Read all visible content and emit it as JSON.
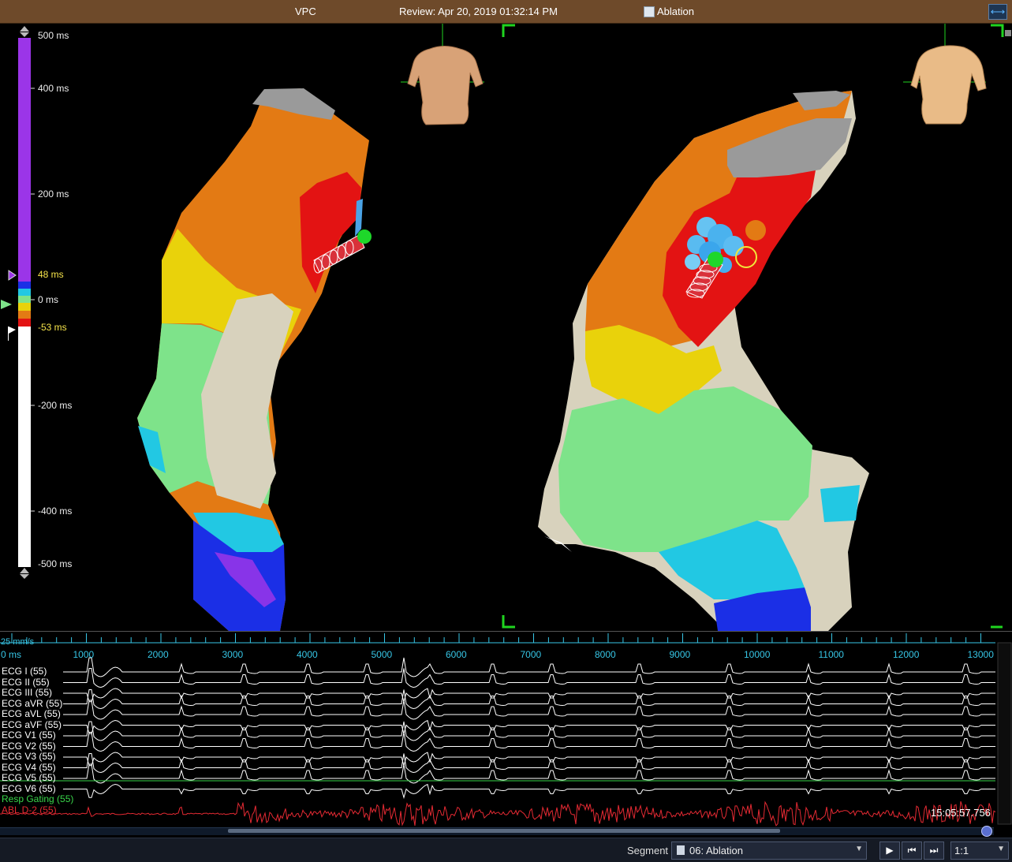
{
  "titlebar": {
    "left": "VPC",
    "center": "Review: Apr 20, 2019 01:32:14 PM",
    "right": "Ablation",
    "expand_icon": "expand-horizontal-icon"
  },
  "colors": {
    "titlebar_bg": "#6e4a2a",
    "purple": "#9b35e8",
    "blue": "#1b2fe6",
    "cyan": "#22c8e3",
    "green": "#7ee38a",
    "yellow": "#e9d20b",
    "orange": "#e37a14",
    "red": "#e31313",
    "white": "#ffffff",
    "ecg_trace": "#ffffff",
    "resp_trace": "#39d64a",
    "abl_trace": "#e52a33",
    "ruler": "#37c6e6"
  },
  "scale": {
    "labels": [
      "500 ms",
      "400 ms",
      "200 ms",
      "48 ms",
      "0 ms",
      "-53 ms",
      "-200 ms",
      "-400 ms",
      "-500 ms"
    ]
  },
  "ecg": {
    "speed": "25 mm/s",
    "ruler_ticks": [
      "0 ms",
      "1000",
      "2000",
      "3000",
      "4000",
      "5000",
      "6000",
      "7000",
      "8000",
      "9000",
      "10000",
      "11000",
      "12000",
      "13000"
    ],
    "channels": [
      "ECG I (55)",
      "ECG II (55)",
      "ECG III (55)",
      "ECG aVR (55)",
      "ECG aVL (55)",
      "ECG aVF (55)",
      "ECG V1 (55)",
      "ECG V2 (55)",
      "ECG V3 (55)",
      "ECG V4 (55)",
      "ECG V5 (55)",
      "ECG V6 (55)"
    ],
    "resp_label": "Resp Gating (55)",
    "abl_label": "ABL  D-2 (55)",
    "timestamp": "15:05:57.756"
  },
  "statusbar": {
    "segment_label": "Segment",
    "segment_value": "06: Ablation",
    "zoom_value": "1:1",
    "play_icon": "play-icon",
    "prev_icon": "step-back-icon",
    "next_icon": "step-forward-icon"
  }
}
